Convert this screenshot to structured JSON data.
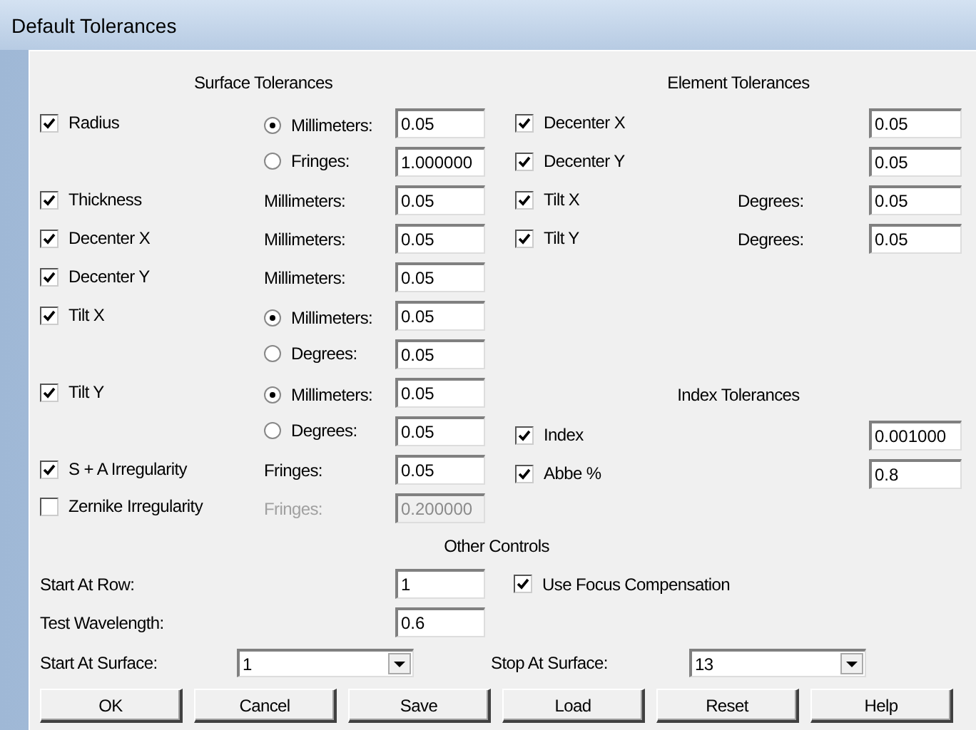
{
  "window": {
    "title": "Default Tolerances"
  },
  "surface": {
    "title": "Surface Tolerances",
    "rows": [
      {
        "check": {
          "label": "Radius",
          "checked": true
        },
        "option": {
          "kind": "radio",
          "label": "Millimeters:",
          "selected": true
        },
        "value": "0.05",
        "disabled": false
      },
      {
        "option": {
          "kind": "radio",
          "label": "Fringes:",
          "selected": false
        },
        "value": "1.000000",
        "disabled": false
      },
      {
        "check": {
          "label": "Thickness",
          "checked": true
        },
        "option": {
          "kind": "label",
          "label": "Millimeters:"
        },
        "value": "0.05",
        "disabled": false
      },
      {
        "check": {
          "label": "Decenter X",
          "checked": true
        },
        "option": {
          "kind": "label",
          "label": "Millimeters:"
        },
        "value": "0.05",
        "disabled": false
      },
      {
        "check": {
          "label": "Decenter Y",
          "checked": true
        },
        "option": {
          "kind": "label",
          "label": "Millimeters:"
        },
        "value": "0.05",
        "disabled": false
      },
      {
        "check": {
          "label": "Tilt X",
          "checked": true
        },
        "option": {
          "kind": "radio",
          "label": "Millimeters:",
          "selected": true
        },
        "value": "0.05",
        "disabled": false
      },
      {
        "option": {
          "kind": "radio",
          "label": "Degrees:",
          "selected": false
        },
        "value": "0.05",
        "disabled": false
      },
      {
        "check": {
          "label": "Tilt Y",
          "checked": true
        },
        "option": {
          "kind": "radio",
          "label": "Millimeters:",
          "selected": true
        },
        "value": "0.05",
        "disabled": false
      },
      {
        "option": {
          "kind": "radio",
          "label": "Degrees:",
          "selected": false
        },
        "value": "0.05",
        "disabled": false
      },
      {
        "check": {
          "label": "S + A Irregularity",
          "checked": true
        },
        "option": {
          "kind": "label",
          "label": "Fringes:"
        },
        "value": "0.05",
        "disabled": false
      },
      {
        "check": {
          "label": "Zernike Irregularity",
          "checked": false
        },
        "option": {
          "kind": "label",
          "label": "Fringes:"
        },
        "value": "0.200000",
        "disabled": true
      }
    ]
  },
  "element": {
    "title": "Element Tolerances",
    "rows": [
      {
        "label": "Decenter X",
        "checked": true,
        "value": "0.05"
      },
      {
        "label": "Decenter Y",
        "checked": true,
        "value": "0.05"
      },
      {
        "label": "Tilt X",
        "checked": true,
        "unit": "Degrees:",
        "value": "0.05"
      },
      {
        "label": "Tilt Y",
        "checked": true,
        "unit": "Degrees:",
        "value": "0.05"
      }
    ]
  },
  "index": {
    "title": "Index Tolerances",
    "rows": [
      {
        "label": "Index",
        "checked": true,
        "value": "0.001000"
      },
      {
        "label": "Abbe %",
        "checked": true,
        "value": "0.8"
      }
    ]
  },
  "other": {
    "title": "Other Controls",
    "start_row": {
      "label": "Start At Row:",
      "value": "1"
    },
    "focus": {
      "label": "Use Focus Compensation",
      "checked": true
    },
    "wavelength": {
      "label": "Test Wavelength:",
      "value": "0.6"
    },
    "start_surface": {
      "label": "Start At Surface:",
      "value": "1"
    },
    "stop_surface": {
      "label": "Stop At Surface:",
      "value": "13"
    }
  },
  "buttons": [
    "OK",
    "Cancel",
    "Save",
    "Load",
    "Reset",
    "Help"
  ]
}
